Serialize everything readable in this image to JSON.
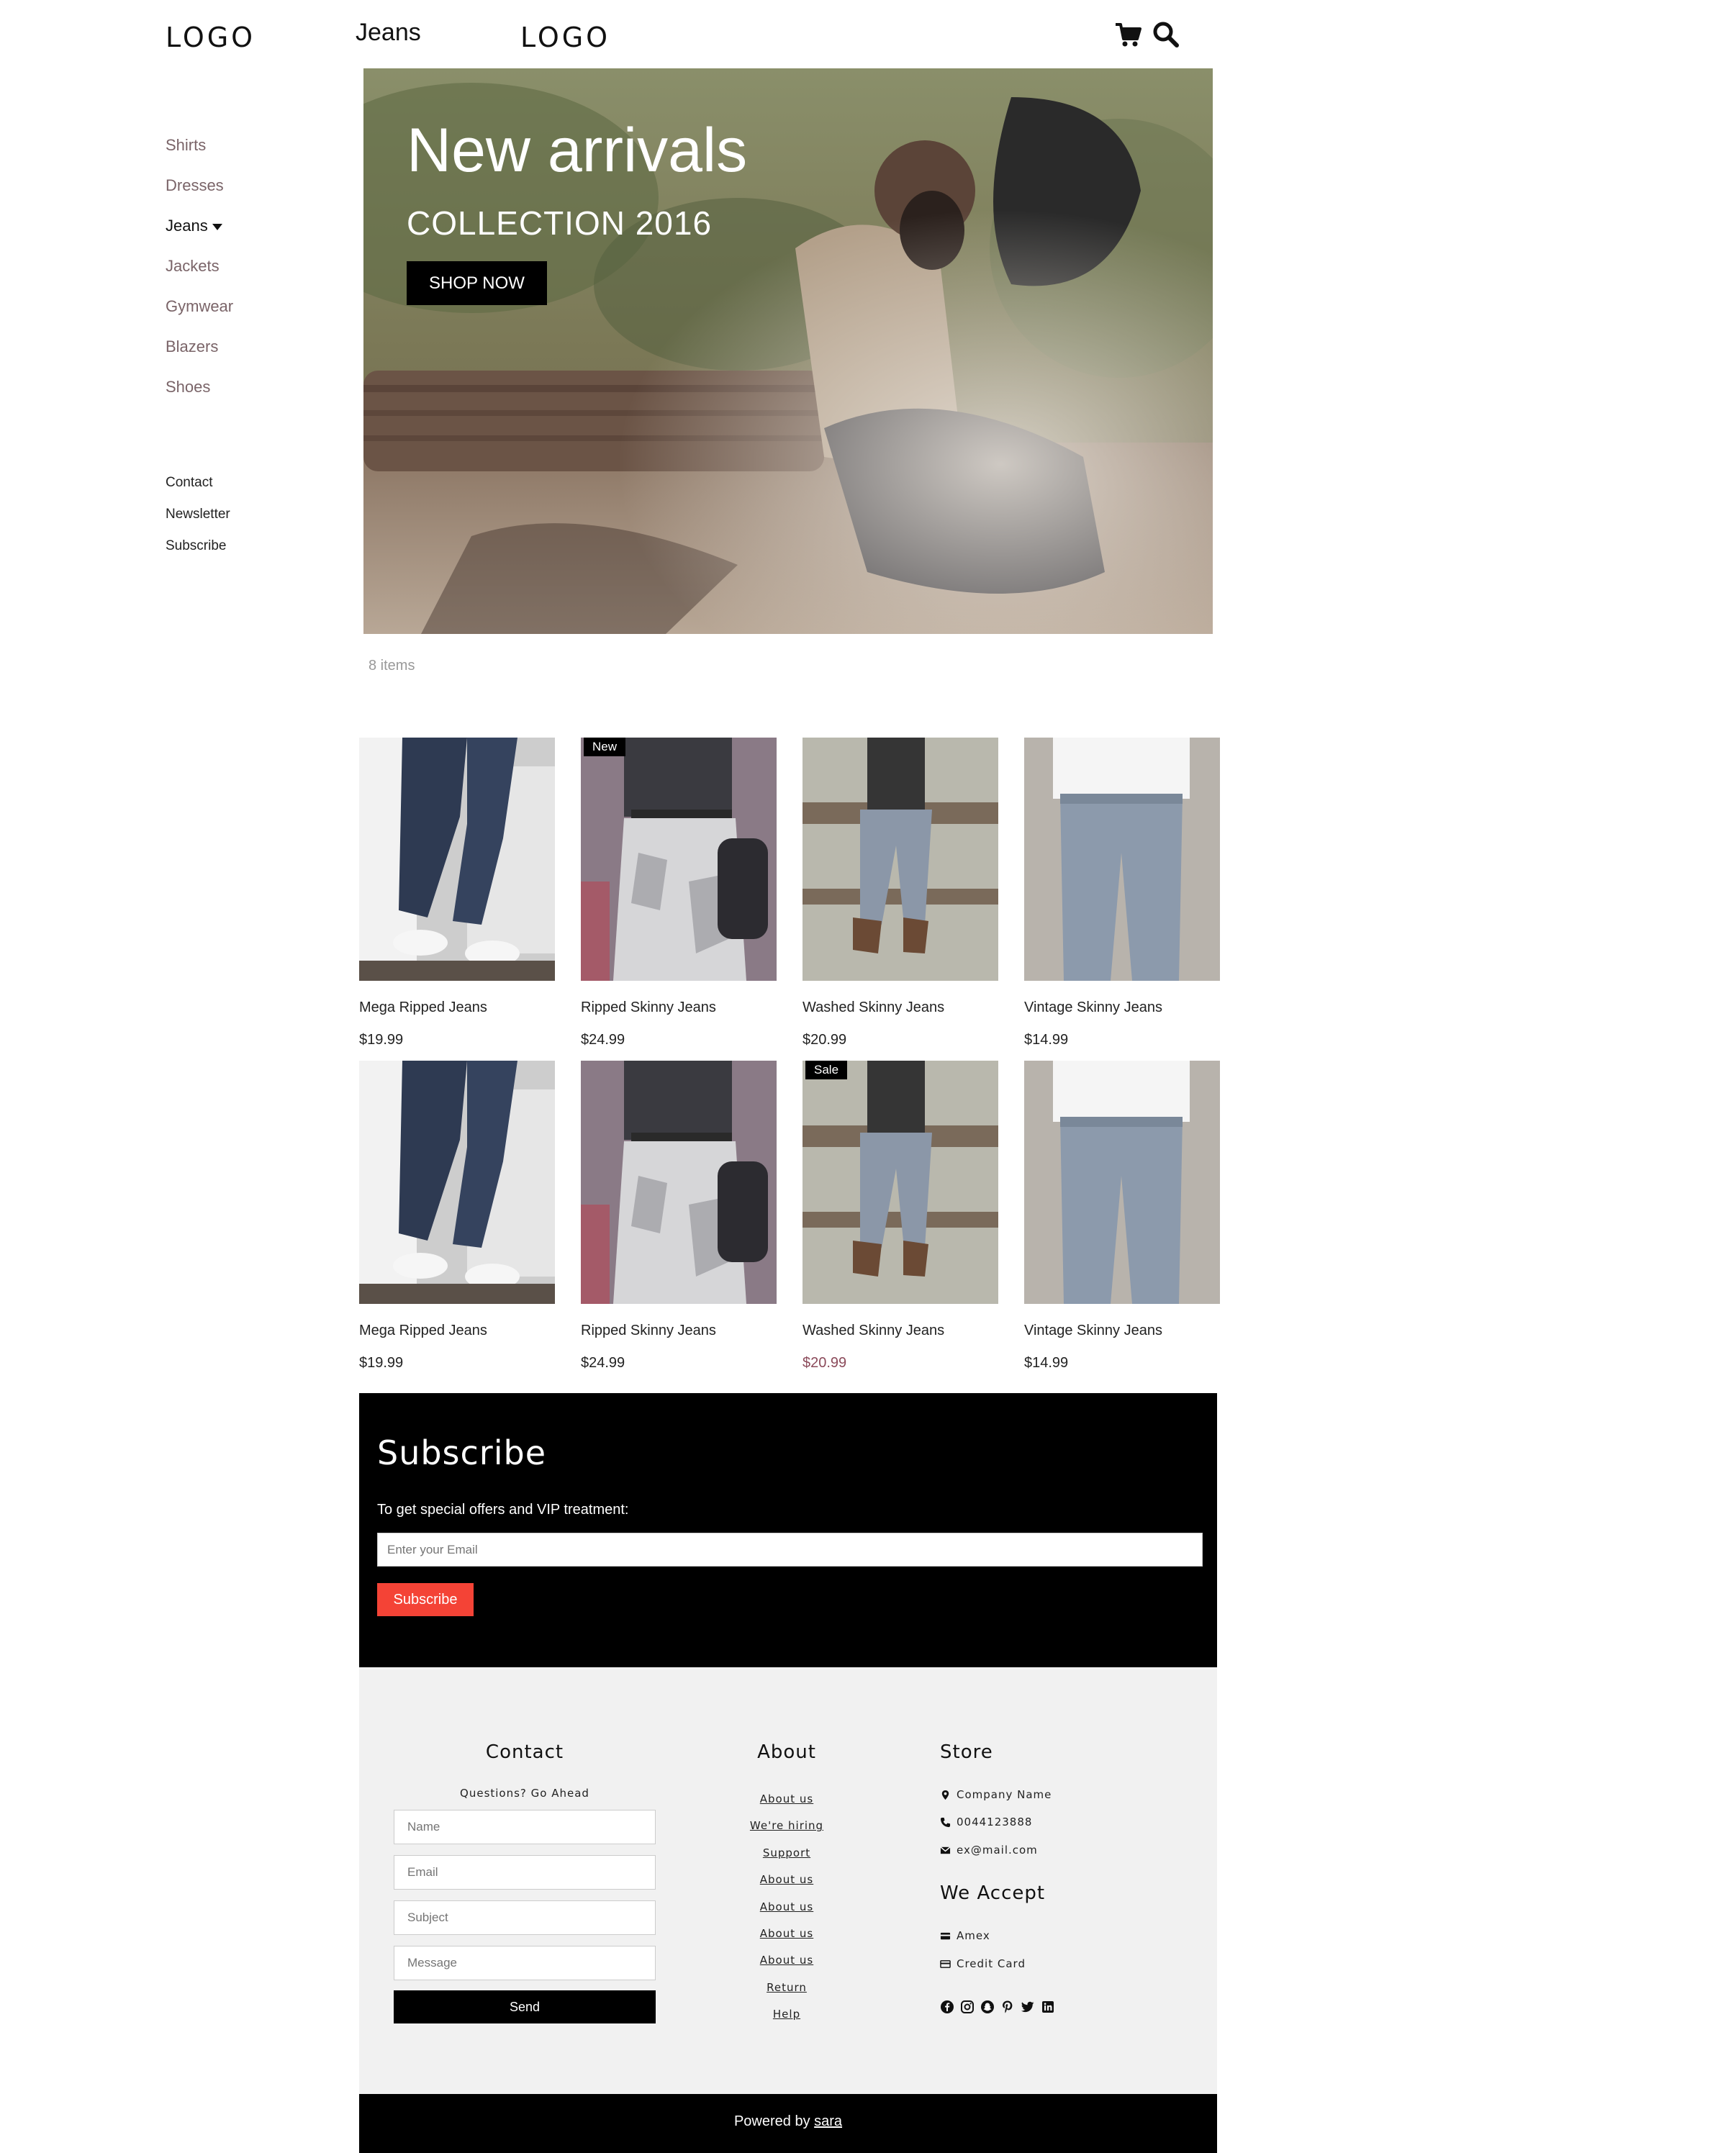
{
  "header": {
    "logo_left": "LOGO",
    "page_title": "Jeans",
    "logo_center": "LOGO",
    "cart_icon": "shopping-cart-icon",
    "search_icon": "search-icon"
  },
  "sidebar": {
    "categories": [
      {
        "label": "Shirts"
      },
      {
        "label": "Dresses"
      },
      {
        "label": "Jeans"
      },
      {
        "label": "Jackets"
      },
      {
        "label": "Gymwear"
      },
      {
        "label": "Blazers"
      },
      {
        "label": "Shoes"
      }
    ],
    "active_category": "Jeans",
    "links": [
      {
        "label": "Contact"
      },
      {
        "label": "Newsletter"
      },
      {
        "label": "Subscribe"
      }
    ]
  },
  "hero": {
    "title": "New arrivals",
    "subtitle": "COLLECTION 2016",
    "button_label": "SHOP NOW"
  },
  "items_count": "8 items",
  "products": [
    {
      "name": "Mega Ripped Jeans",
      "price": "$19.99",
      "badge": ""
    },
    {
      "name": "Ripped Skinny Jeans",
      "price": "$24.99",
      "badge": "New"
    },
    {
      "name": "Washed Skinny Jeans",
      "price": "$20.99",
      "badge": ""
    },
    {
      "name": "Vintage Skinny Jeans",
      "price": "$14.99",
      "badge": ""
    },
    {
      "name": "Mega Ripped Jeans",
      "price": "$19.99",
      "badge": ""
    },
    {
      "name": "Ripped Skinny Jeans",
      "price": "$24.99",
      "badge": ""
    },
    {
      "name": "Washed Skinny Jeans",
      "price": "$20.99",
      "badge": "Sale"
    },
    {
      "name": "Vintage Skinny Jeans",
      "price": "$14.99",
      "badge": ""
    }
  ],
  "subscribe": {
    "title": "Subscribe",
    "text": "To get special offers and VIP treatment:",
    "email_placeholder": "Enter your Email",
    "button_label": "Subscribe",
    "button_color": "#f44336"
  },
  "footer": {
    "contact": {
      "title": "Contact",
      "subtitle": "Questions? Go Ahead",
      "name_placeholder": "Name",
      "email_placeholder": "Email",
      "subject_placeholder": "Subject",
      "message_placeholder": "Message",
      "send_label": "Send"
    },
    "about": {
      "title": "About",
      "links": [
        "About us",
        "We're hiring",
        "Support",
        "About us",
        "About us",
        "About us",
        "About us",
        "Return",
        "Help"
      ]
    },
    "store": {
      "title": "Store",
      "company": "Company Name",
      "phone": "0044123888",
      "email": "ex@mail.com",
      "accept_title": "We Accept",
      "payments": [
        "Amex",
        "Credit Card"
      ],
      "social_icons": [
        "facebook-icon",
        "instagram-icon",
        "snapchat-icon",
        "pinterest-icon",
        "twitter-icon",
        "linkedin-icon"
      ]
    }
  },
  "bottom": {
    "powered_prefix": "Powered by",
    "powered_link": "sara"
  },
  "colors": {
    "sidebar_category": "#7a6468",
    "sale_price": "#8b4a5a",
    "footer_bg": "#f1f1f1"
  }
}
